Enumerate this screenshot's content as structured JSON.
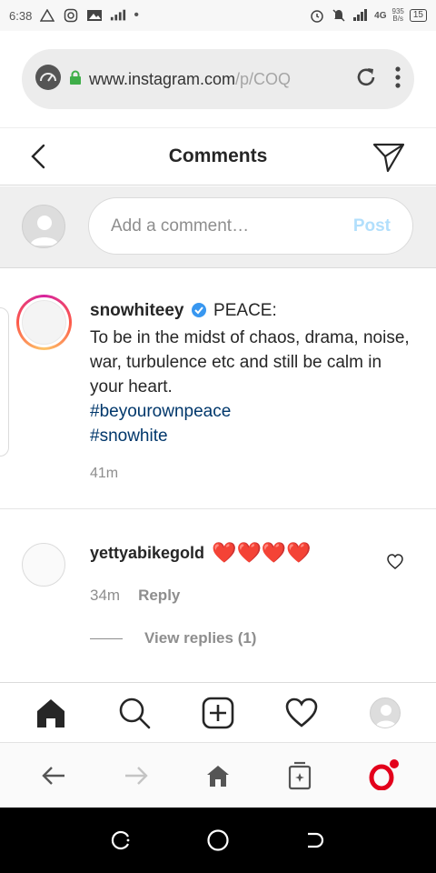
{
  "status_bar": {
    "time": "6:38",
    "signal_label": "4G",
    "netspeed_value": "935",
    "netspeed_unit": "B/s",
    "battery": "15"
  },
  "browser": {
    "url_domain": "www.instagram.com",
    "url_path": "/p/COQ"
  },
  "header": {
    "title": "Comments"
  },
  "add_comment": {
    "placeholder": "Add a comment…",
    "post_label": "Post"
  },
  "caption": {
    "username": "snowhiteey",
    "first_line": "PEACE:",
    "text": "To be in the midst of chaos, drama, noise, war, turbulence etc and still be calm in your heart.",
    "hashtags": [
      "#beyourownpeace",
      "#snowhite"
    ],
    "time": "41m"
  },
  "comments": [
    {
      "username": "yettyabikegold",
      "text": "❤️❤️❤️❤️",
      "time": "34m",
      "reply_label": "Reply",
      "view_replies_label": "View replies (1)"
    }
  ],
  "colors": {
    "link": "#00376b",
    "post_disabled": "#b2dffc",
    "heart": "#e0245e",
    "opera_red": "#e3001b"
  },
  "icons": {
    "status_bar": [
      "alert-icon",
      "instagram-icon",
      "gallery-icon",
      "signal-icon",
      "alarm-icon",
      "mute-icon"
    ],
    "browser": [
      "speed-dial-icon",
      "lock-icon",
      "reload-icon",
      "menu-icon"
    ],
    "ig_nav": [
      "home-icon",
      "search-icon",
      "new-post-icon",
      "activity-icon",
      "profile-icon"
    ],
    "opera_bar": [
      "back-icon",
      "forward-icon",
      "home-icon",
      "tabs-icon",
      "opera-menu-icon"
    ],
    "android_nav": [
      "recents-icon",
      "home-icon",
      "back-icon"
    ]
  }
}
